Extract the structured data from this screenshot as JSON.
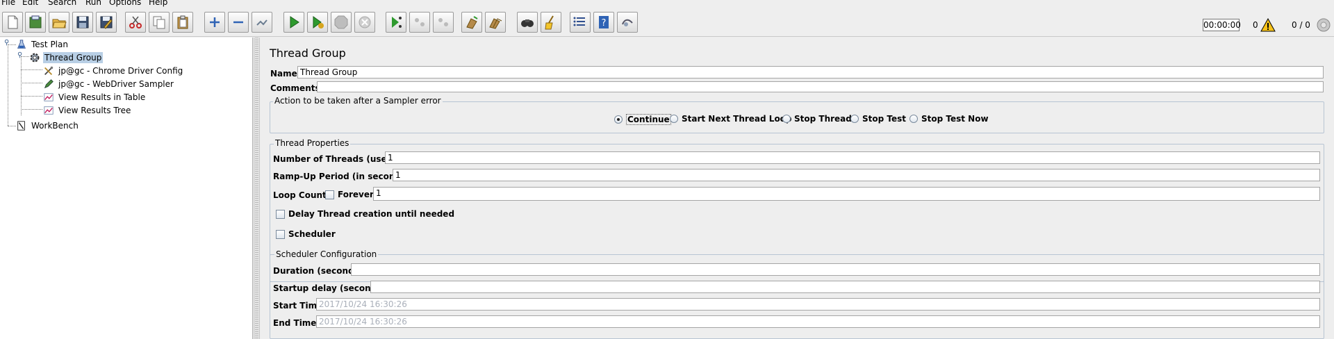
{
  "menu": [
    "File",
    "Edit",
    "Search",
    "Run",
    "Options",
    "Help"
  ],
  "toolbar": {
    "buttons": [
      {
        "name": "new-icon"
      },
      {
        "name": "templates-icon"
      },
      {
        "name": "open-icon"
      },
      {
        "name": "save-icon"
      },
      {
        "name": "save-as-icon"
      },
      {
        "name": "cut-icon"
      },
      {
        "name": "copy-icon"
      },
      {
        "name": "paste-icon"
      },
      {
        "name": "expand-icon"
      },
      {
        "name": "collapse-icon"
      },
      {
        "name": "toggle-icon"
      },
      {
        "name": "start-icon"
      },
      {
        "name": "start-no-pauses-icon"
      },
      {
        "name": "stop-icon"
      },
      {
        "name": "shutdown-icon"
      },
      {
        "name": "remote-start-icon"
      },
      {
        "name": "remote-stop-icon"
      },
      {
        "name": "remote-shutdown-icon"
      },
      {
        "name": "clear-icon"
      },
      {
        "name": "clear-all-icon"
      },
      {
        "name": "search-icon"
      },
      {
        "name": "reset-search-icon"
      },
      {
        "name": "function-helper-icon"
      },
      {
        "name": "help-icon"
      },
      {
        "name": "log-viewer-icon"
      }
    ],
    "timer": "00:00:00",
    "warning_count": "0",
    "threads": "0 / 0"
  },
  "tree": {
    "nodes": [
      {
        "label": "Test Plan",
        "icon": "test-plan-icon"
      },
      {
        "label": "Thread Group",
        "icon": "gear-icon"
      },
      {
        "label": "jp@gc - Chrome Driver Config",
        "icon": "tools-icon"
      },
      {
        "label": "jp@gc - WebDriver Sampler",
        "icon": "pen-icon"
      },
      {
        "label": "View Results in Table",
        "icon": "chart-icon"
      },
      {
        "label": "View Results Tree",
        "icon": "chart-icon"
      },
      {
        "label": "WorkBench",
        "icon": "workbench-icon"
      }
    ]
  },
  "panel": {
    "title": "Thread Group",
    "name_label": "Name:",
    "name_value": "Thread Group",
    "comments_label": "Comments:",
    "comments_value": ""
  },
  "error_action": {
    "legend": "Action to be taken after a Sampler error",
    "options": [
      "Continue",
      "Start Next Thread Loop",
      "Stop Thread",
      "Stop Test",
      "Stop Test Now"
    ],
    "selected": "Continue"
  },
  "thread_props": {
    "legend": "Thread Properties",
    "threads_label": "Number of Threads (users):",
    "threads_value": "1",
    "rampup_label": "Ramp-Up Period (in seconds):",
    "rampup_value": "1",
    "loop_label": "Loop Count:",
    "forever_label": "Forever",
    "loop_value": "1",
    "delay_label": "Delay Thread creation until needed",
    "scheduler_label": "Scheduler"
  },
  "scheduler": {
    "legend": "Scheduler Configuration",
    "duration_label": "Duration (seconds)",
    "duration_value": "",
    "startup_label": "Startup delay (seconds)",
    "startup_value": "",
    "start_label": "Start Time",
    "start_value": "2017/10/24 16:30:26",
    "end_label": "End Time",
    "end_value": "2017/10/24 16:30:26"
  }
}
